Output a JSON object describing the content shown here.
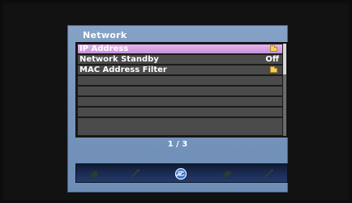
{
  "menu": {
    "title": "Network",
    "rows": [
      {
        "label": "IP Address",
        "value": "",
        "icon": "folder-icon",
        "selected": true
      },
      {
        "label": "Network Standby",
        "value": "Off",
        "icon": "",
        "selected": false
      },
      {
        "label": "MAC Address Filter",
        "value": "",
        "icon": "folder-icon",
        "selected": false
      },
      {
        "label": "",
        "value": "",
        "icon": "",
        "selected": false
      },
      {
        "label": "",
        "value": "",
        "icon": "",
        "selected": false
      },
      {
        "label": "",
        "value": "",
        "icon": "",
        "selected": false
      },
      {
        "label": "",
        "value": "",
        "icon": "",
        "selected": false
      },
      {
        "label": "",
        "value": "",
        "icon": "",
        "selected": false
      },
      {
        "label": "",
        "value": "",
        "icon": "",
        "selected": false
      }
    ],
    "page_indicator": "1 / 3",
    "scroll_position": "1 of 3"
  },
  "icon_bar": {
    "items": [
      {
        "name": "speaker-icon",
        "active": false
      },
      {
        "name": "cable-icon",
        "active": false
      },
      {
        "name": "network-globe-icon",
        "active": true
      },
      {
        "name": "input-icon",
        "active": false
      },
      {
        "name": "tools-icon",
        "active": false
      }
    ]
  },
  "colors": {
    "panel": "#7896bd",
    "selected_row": "#d8a2e4",
    "row": "#4b4b4b",
    "icon_bar": "#1c2d55"
  }
}
